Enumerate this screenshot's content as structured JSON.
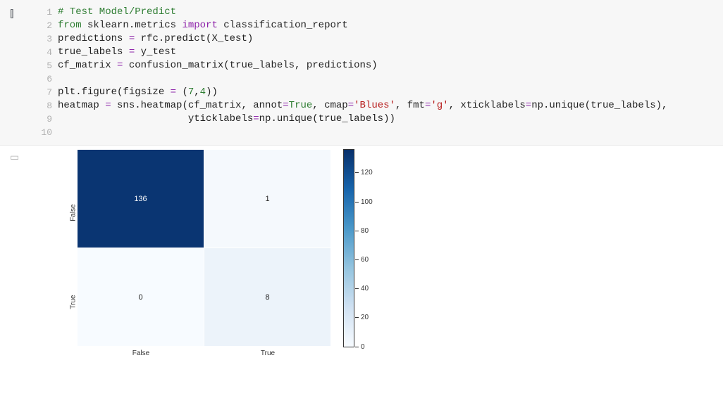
{
  "code": {
    "lines": [
      {
        "n": "1",
        "tokens": [
          {
            "cls": "tk-comment",
            "t": "# Test Model/Predict"
          }
        ]
      },
      {
        "n": "2",
        "tokens": [
          {
            "cls": "tk-keyword",
            "t": "from"
          },
          {
            "cls": "tk-name",
            "t": " sklearn.metrics "
          },
          {
            "cls": "tk-import",
            "t": "import"
          },
          {
            "cls": "tk-name",
            "t": " classification_report"
          }
        ]
      },
      {
        "n": "3",
        "tokens": [
          {
            "cls": "tk-name",
            "t": "predictions "
          },
          {
            "cls": "tk-op",
            "t": "="
          },
          {
            "cls": "tk-name",
            "t": " rfc.predict(X_test)"
          }
        ]
      },
      {
        "n": "4",
        "tokens": [
          {
            "cls": "tk-name",
            "t": "true_labels "
          },
          {
            "cls": "tk-op",
            "t": "="
          },
          {
            "cls": "tk-name",
            "t": " y_test"
          }
        ]
      },
      {
        "n": "5",
        "tokens": [
          {
            "cls": "tk-name",
            "t": "cf_matrix "
          },
          {
            "cls": "tk-op",
            "t": "="
          },
          {
            "cls": "tk-name",
            "t": " confusion_matrix(true_labels, predictions)"
          }
        ]
      },
      {
        "n": "6",
        "tokens": [
          {
            "cls": "tk-name",
            "t": ""
          }
        ]
      },
      {
        "n": "7",
        "tokens": [
          {
            "cls": "tk-name",
            "t": "plt.figure(figsize "
          },
          {
            "cls": "tk-op",
            "t": "="
          },
          {
            "cls": "tk-name",
            "t": " ("
          },
          {
            "cls": "tk-builtin",
            "t": "7"
          },
          {
            "cls": "tk-name",
            "t": ","
          },
          {
            "cls": "tk-builtin",
            "t": "4"
          },
          {
            "cls": "tk-name",
            "t": "))"
          }
        ]
      },
      {
        "n": "8",
        "tokens": [
          {
            "cls": "tk-name",
            "t": "heatmap "
          },
          {
            "cls": "tk-op",
            "t": "="
          },
          {
            "cls": "tk-name",
            "t": " sns.heatmap(cf_matrix, annot"
          },
          {
            "cls": "tk-op",
            "t": "="
          },
          {
            "cls": "tk-builtin",
            "t": "True"
          },
          {
            "cls": "tk-name",
            "t": ", cmap"
          },
          {
            "cls": "tk-op",
            "t": "="
          },
          {
            "cls": "tk-string",
            "t": "'Blues'"
          },
          {
            "cls": "tk-name",
            "t": ", fmt"
          },
          {
            "cls": "tk-op",
            "t": "="
          },
          {
            "cls": "tk-string",
            "t": "'g'"
          },
          {
            "cls": "tk-name",
            "t": ", xticklabels"
          },
          {
            "cls": "tk-op",
            "t": "="
          },
          {
            "cls": "tk-name",
            "t": "np.unique(true_labels),"
          }
        ]
      },
      {
        "n": "9",
        "tokens": [
          {
            "cls": "tk-name",
            "t": "                      yticklabels"
          },
          {
            "cls": "tk-op",
            "t": "="
          },
          {
            "cls": "tk-name",
            "t": "np.unique(true_labels))"
          }
        ]
      },
      {
        "n": "10",
        "tokens": [
          {
            "cls": "tk-name",
            "t": ""
          }
        ]
      }
    ]
  },
  "chart_data": {
    "type": "heatmap",
    "x_categories": [
      "False",
      "True"
    ],
    "y_categories": [
      "False",
      "True"
    ],
    "matrix": [
      [
        136,
        1
      ],
      [
        0,
        8
      ]
    ],
    "cmap": "Blues",
    "colorbar_ticks": [
      "120",
      "100",
      "80",
      "60",
      "40",
      "20",
      "0"
    ],
    "cell_colors": [
      [
        "#0a3572",
        "#f5f9fd"
      ],
      [
        "#f7fbff",
        "#ecf3fa"
      ]
    ],
    "text_colors": [
      [
        "#ffffff",
        "#222222"
      ],
      [
        "#222222",
        "#222222"
      ]
    ]
  }
}
